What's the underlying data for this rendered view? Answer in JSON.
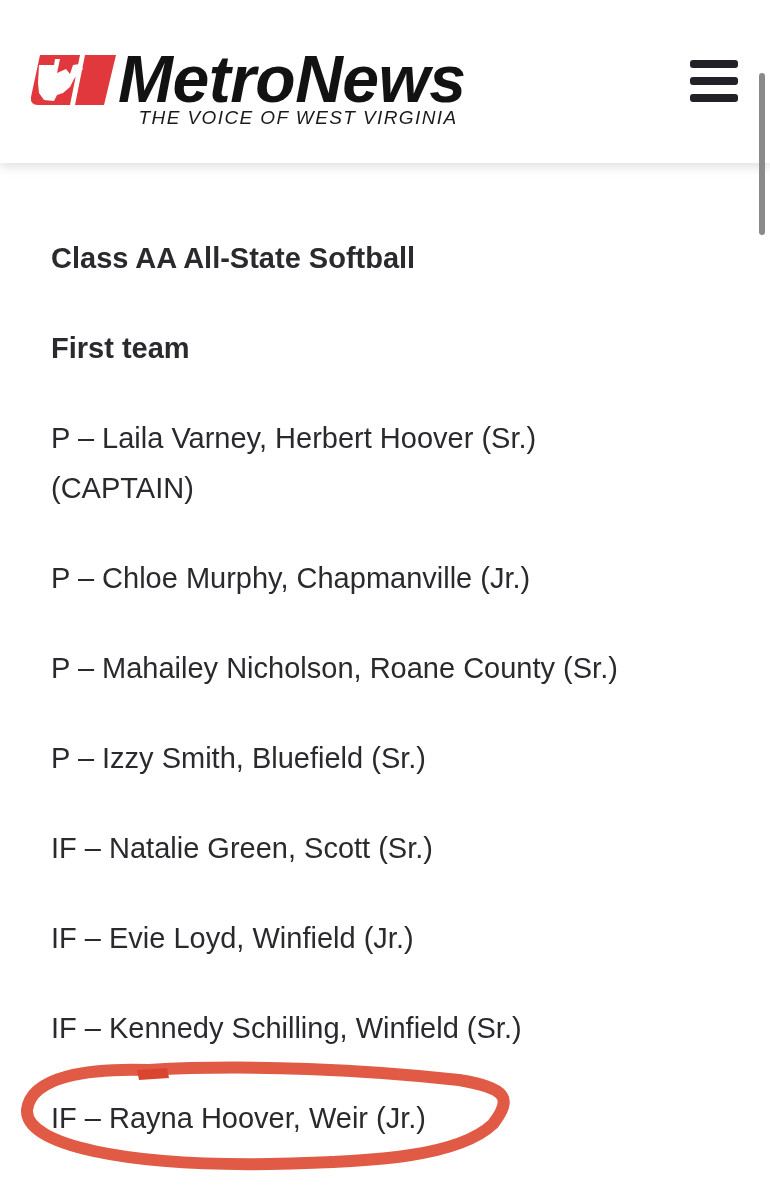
{
  "header": {
    "logo": {
      "wordmark": "MetroNews",
      "tagline": "THE VOICE OF WEST VIRGINIA"
    }
  },
  "article": {
    "title": "Class AA All-State Softball",
    "section": "First team",
    "entries": [
      {
        "text": "P – Laila Varney, Herbert Hoover (Sr.) (CAPTAIN)",
        "highlighted": false
      },
      {
        "text": "P – Chloe Murphy, Chapmanville (Jr.)",
        "highlighted": false
      },
      {
        "text": "P – Mahailey Nicholson, Roane County (Sr.)",
        "highlighted": false
      },
      {
        "text": "P – Izzy Smith, Bluefield (Sr.)",
        "highlighted": false
      },
      {
        "text": "IF – Natalie Green, Scott (Sr.)",
        "highlighted": false
      },
      {
        "text": "IF – Evie Loyd, Winfield (Jr.)",
        "highlighted": false
      },
      {
        "text": "IF – Kennedy Schilling, Winfield (Sr.)",
        "highlighted": false
      },
      {
        "text": "IF – Rayna Hoover, Weir (Jr.)",
        "highlighted": true
      }
    ]
  }
}
